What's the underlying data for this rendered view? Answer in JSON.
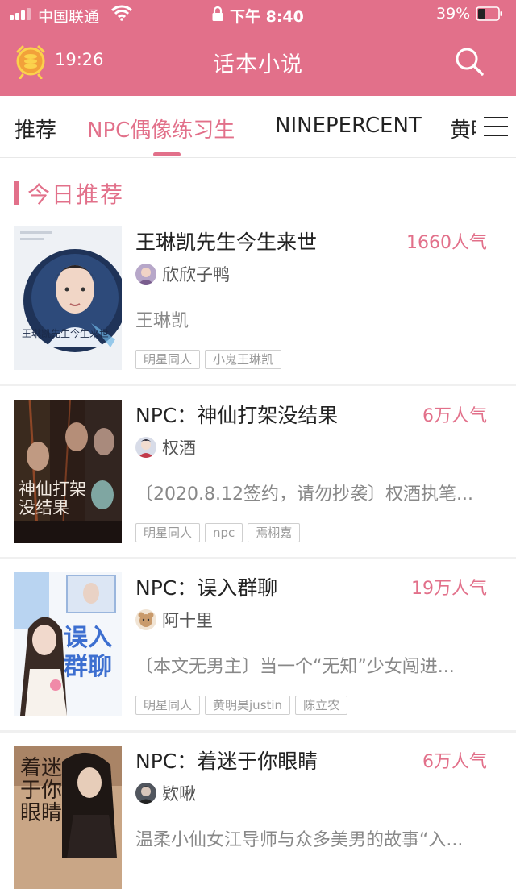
{
  "status_bar": {
    "carrier": "中国联通",
    "time": "下午 8:40",
    "battery_percent": "39%",
    "battery_level": 0.39
  },
  "header": {
    "timer": "19:26",
    "title": "话本小说",
    "colors": {
      "brand": "#e2708a",
      "text_on_brand": "#ffffff"
    }
  },
  "tabs": [
    {
      "label": "推荐",
      "active": false
    },
    {
      "label": "NPC偶像练习生",
      "active": true
    },
    {
      "label": "NINEPERCENT",
      "active": false
    },
    {
      "label": "黄明",
      "active": false
    }
  ],
  "section": {
    "title": "今日推荐"
  },
  "books": [
    {
      "title": "王琳凯先生今生来世",
      "popularity": "1660人气",
      "author": "欣欣子鸭",
      "description": "王琳凯",
      "tags": [
        "明星同人",
        "小鬼王琳凯"
      ],
      "cover_text": "王琳凯先生今生来世"
    },
    {
      "title": "NPC：神仙打架没结果",
      "popularity": "6万人气",
      "author": "权酒",
      "description": "〔2020.8.12签约，请勿抄袭〕权酒执笔...",
      "tags": [
        "明星同人",
        "npc",
        "焉栩嘉"
      ],
      "cover_text": "神仙打架没结果"
    },
    {
      "title": "NPC：误入群聊",
      "popularity": "19万人气",
      "author": "阿十里",
      "description": "〔本文无男主〕当一个“无知”少女闯进...",
      "tags": [
        "明星同人",
        "黄明昊justin",
        "陈立农"
      ],
      "cover_text": "误入群聊"
    },
    {
      "title": " NPC：着迷于你眼睛",
      "popularity": "6万人气",
      "author": "欵啾",
      "description": "温柔小仙女江导师与众多美男的故事“入...",
      "tags": [],
      "cover_text": "着迷于你眼睛"
    }
  ]
}
